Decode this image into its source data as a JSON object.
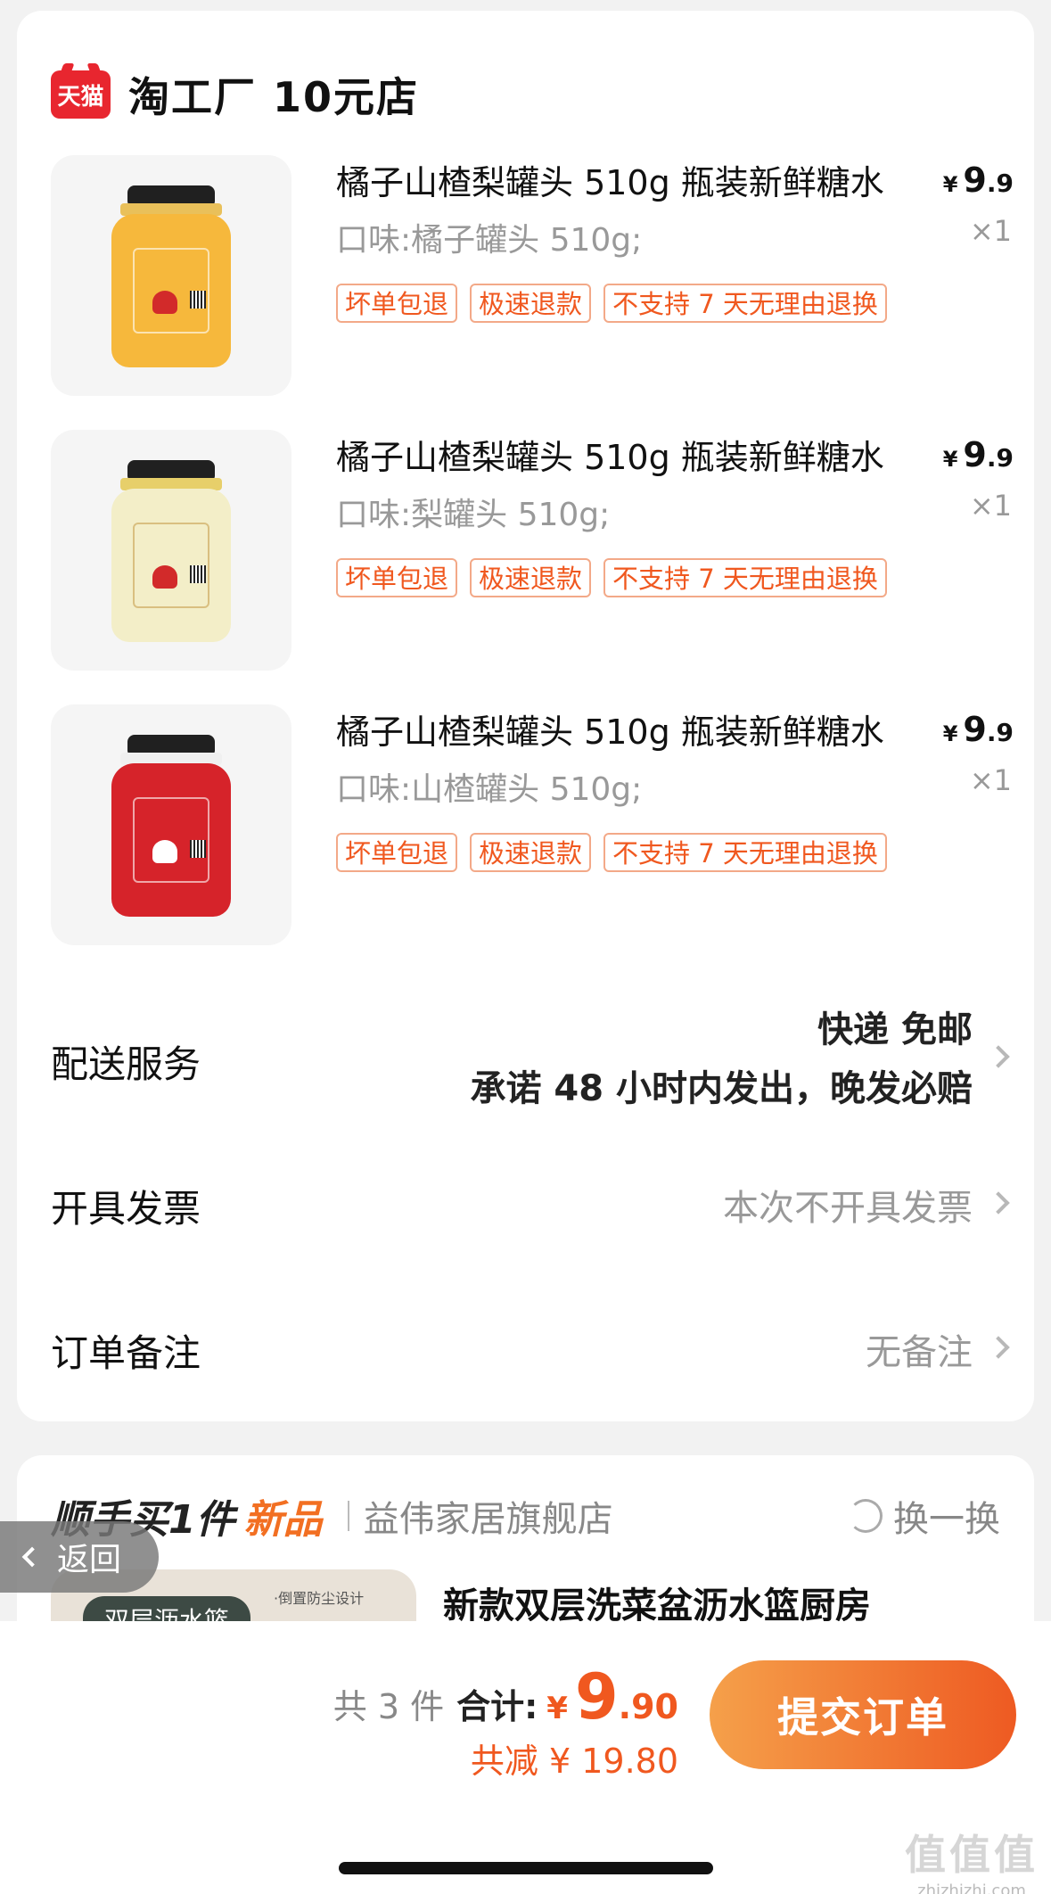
{
  "store": {
    "logo_text": "天猫",
    "name": "淘工厂 10元店"
  },
  "items": [
    {
      "title": "橘子山楂梨罐头 510g 瓶装新鲜糖水",
      "price_yen": "¥",
      "price_int": "9",
      "price_dec": ".9",
      "spec": "口味:橘子罐头 510g;",
      "qty": "×1",
      "tags": [
        "坏单包退",
        "极速退款",
        "不支持 7 天无理由退换"
      ],
      "jar_color": "#f6b83c"
    },
    {
      "title": "橘子山楂梨罐头 510g 瓶装新鲜糖水",
      "price_yen": "¥",
      "price_int": "9",
      "price_dec": ".9",
      "spec": "口味:梨罐头 510g;",
      "qty": "×1",
      "tags": [
        "坏单包退",
        "极速退款",
        "不支持 7 天无理由退换"
      ],
      "jar_color": "#f3eec8"
    },
    {
      "title": "橘子山楂梨罐头 510g 瓶装新鲜糖水",
      "price_yen": "¥",
      "price_int": "9",
      "price_dec": ".9",
      "spec": "口味:山楂罐头 510g;",
      "qty": "×1",
      "tags": [
        "坏单包退",
        "极速退款",
        "不支持 7 天无理由退换"
      ],
      "jar_color": "#d6232a"
    }
  ],
  "delivery": {
    "label": "配送服务",
    "line1": "快递 免邮",
    "line2": "承诺 48 小时内发出，晚发必赔"
  },
  "invoice": {
    "label": "开具发票",
    "value": "本次不开具发票"
  },
  "note": {
    "label": "订单备注",
    "value": "无备注"
  },
  "upsell": {
    "heading": "顺手买1件",
    "new_tag": "新品",
    "store": "益伟家居旗舰店",
    "swap": "换一换",
    "thumb_badge": "双层沥水篮",
    "thumb_note": "·倒置防尘设计",
    "product_title": "新款双层洗菜盆沥水篮厨房"
  },
  "back": {
    "label": "返回"
  },
  "summary": {
    "count": "共 3 件",
    "total_label": "合计:",
    "yen": "¥",
    "total_int": "9",
    "total_dec": ".90",
    "discount": "共减 ¥ 19.80",
    "submit": "提交订单"
  },
  "watermark": {
    "big": "值值值",
    "small": "zhizhizhi.com"
  }
}
